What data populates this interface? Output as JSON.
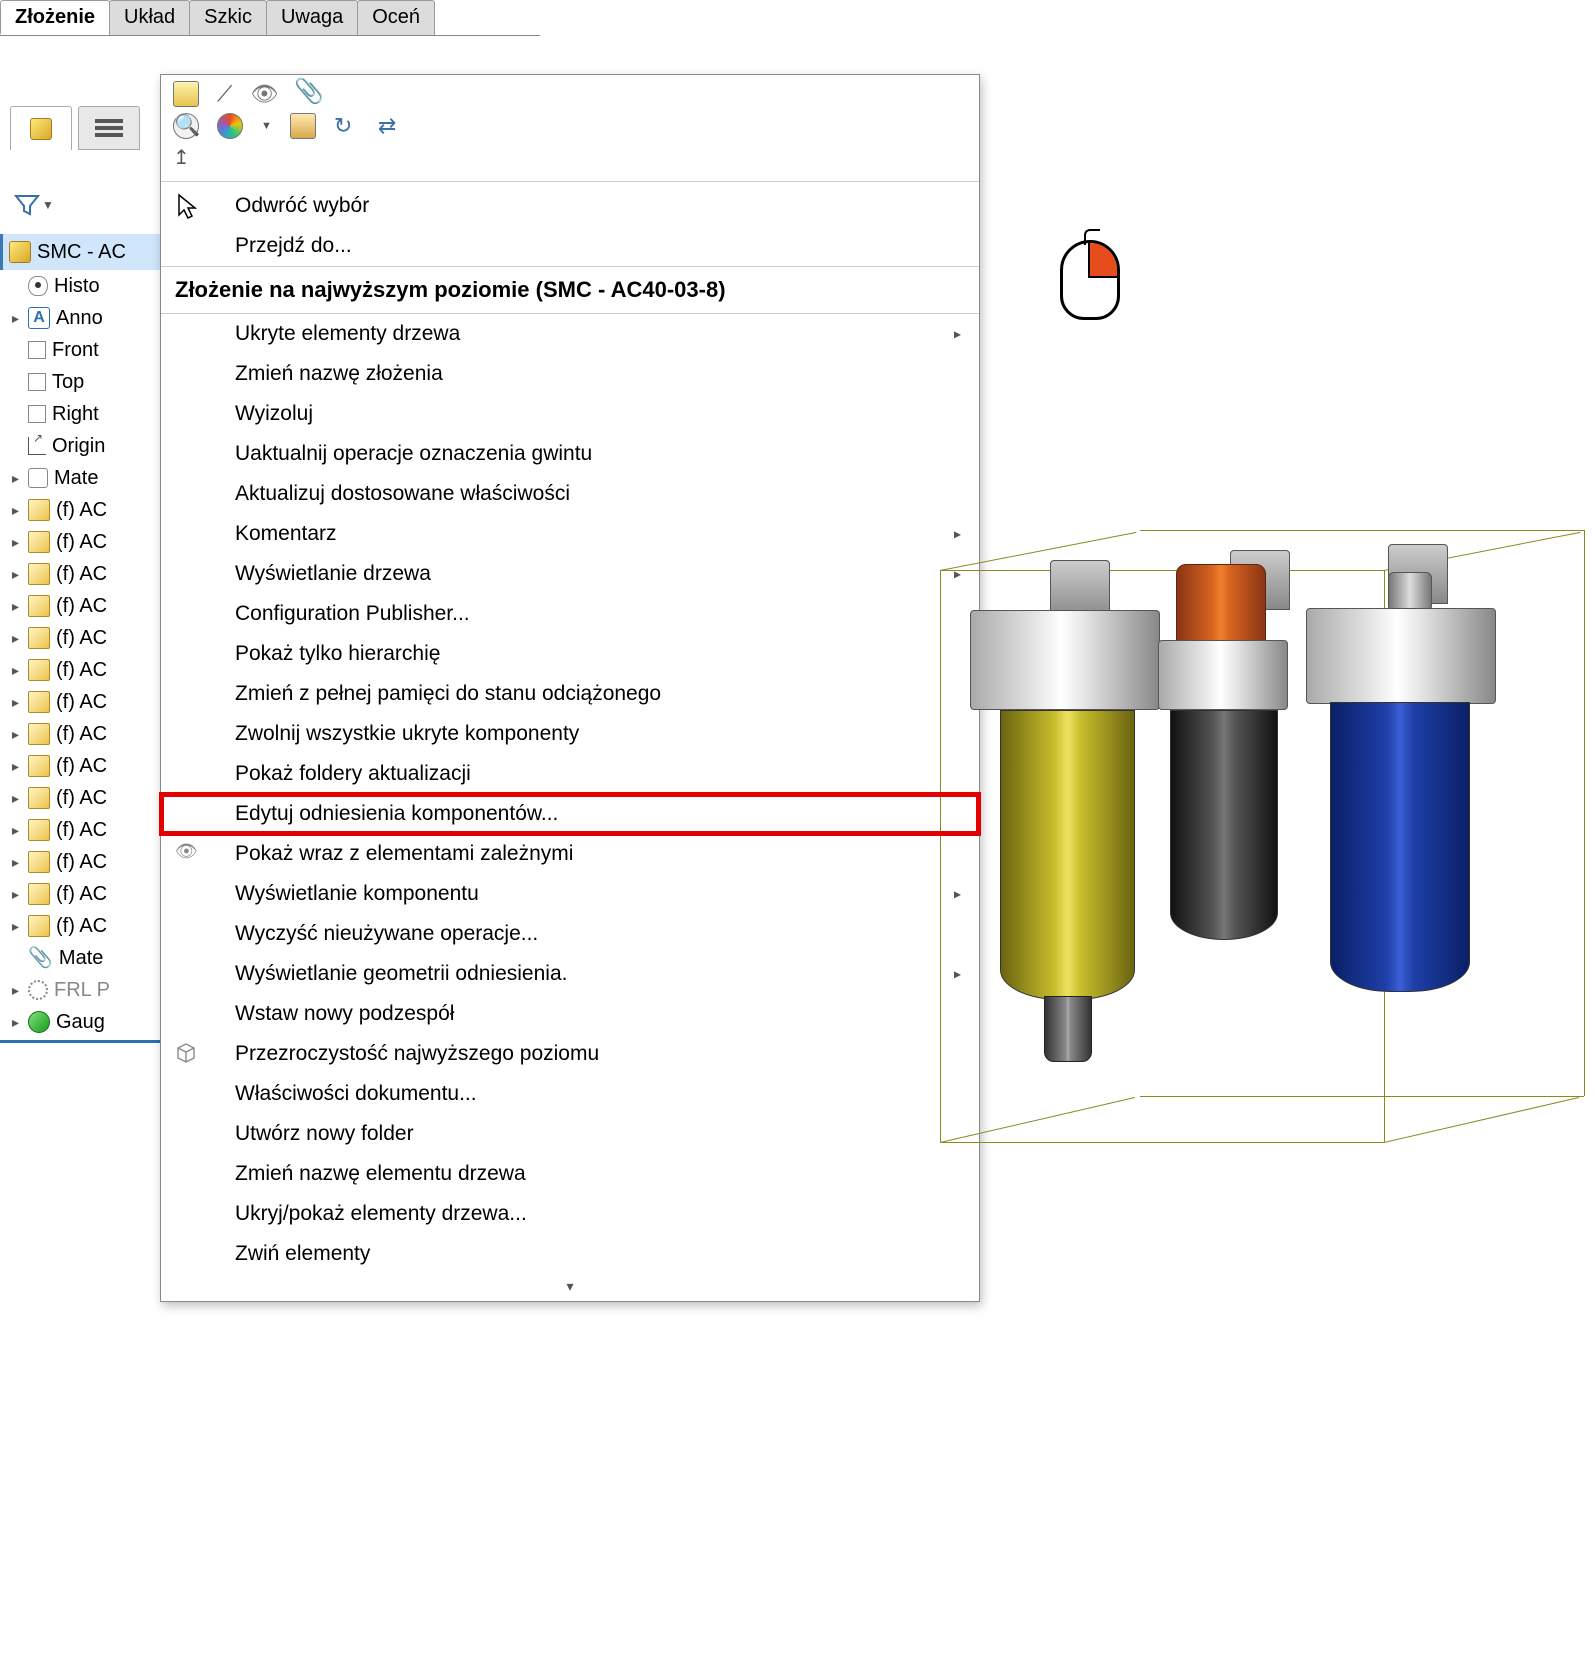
{
  "menubar": {
    "tabs": [
      "Złożenie",
      "Układ",
      "Szkic",
      "Uwaga",
      "Oceń"
    ],
    "active_index": 0
  },
  "tree": {
    "root": "SMC - AC",
    "items": [
      {
        "label": "Histo",
        "icon": "eye",
        "arrow": false
      },
      {
        "label": "Anno",
        "icon": "A",
        "arrow": true
      },
      {
        "label": "Front",
        "icon": "plane",
        "arrow": false
      },
      {
        "label": "Top",
        "icon": "plane",
        "arrow": false
      },
      {
        "label": "Right",
        "icon": "plane",
        "arrow": false
      },
      {
        "label": "Origin",
        "icon": "origin",
        "arrow": false
      },
      {
        "label": "Mate",
        "icon": "mate",
        "arrow": true
      },
      {
        "label": "(f) AC",
        "icon": "part",
        "arrow": true
      },
      {
        "label": "(f) AC",
        "icon": "part",
        "arrow": true
      },
      {
        "label": "(f) AC",
        "icon": "part",
        "arrow": true
      },
      {
        "label": "(f) AC",
        "icon": "part",
        "arrow": true
      },
      {
        "label": "(f) AC",
        "icon": "part",
        "arrow": true
      },
      {
        "label": "(f) AC",
        "icon": "part",
        "arrow": true
      },
      {
        "label": "(f) AC",
        "icon": "part",
        "arrow": true
      },
      {
        "label": "(f) AC",
        "icon": "part",
        "arrow": true
      },
      {
        "label": "(f) AC",
        "icon": "part",
        "arrow": true
      },
      {
        "label": "(f) AC",
        "icon": "part",
        "arrow": true
      },
      {
        "label": "(f) AC",
        "icon": "part",
        "arrow": true
      },
      {
        "label": "(f) AC",
        "icon": "part",
        "arrow": true
      },
      {
        "label": "(f) AC",
        "icon": "part",
        "arrow": true
      },
      {
        "label": "(f) AC",
        "icon": "part",
        "arrow": true
      },
      {
        "label": "Mate",
        "icon": "clip",
        "arrow": false
      },
      {
        "label": "FRL P",
        "icon": "gear",
        "arrow": true,
        "gray": true
      },
      {
        "label": "Gaug",
        "icon": "gauge",
        "arrow": true
      }
    ]
  },
  "context_menu": {
    "top_items": [
      {
        "label": "Odwróć wybór",
        "icon": "cursor"
      },
      {
        "label": "Przejdź do..."
      }
    ],
    "header": "Złożenie na najwyższym poziomie (SMC - AC40-03-8)",
    "items": [
      {
        "label": "Ukryte elementy drzewa",
        "submenu": true
      },
      {
        "label": "Zmień nazwę złożenia"
      },
      {
        "label": "Wyizoluj"
      },
      {
        "label": "Uaktualnij operacje oznaczenia gwintu"
      },
      {
        "label": "Aktualizuj dostosowane właściwości"
      },
      {
        "label": "Komentarz",
        "submenu": true
      },
      {
        "label": "Wyświetlanie drzewa",
        "submenu": true
      },
      {
        "label": "Configuration Publisher..."
      },
      {
        "label": "Pokaż tylko hierarchię"
      },
      {
        "label": "Zmień z pełnej pamięci do stanu odciążonego"
      },
      {
        "label": "Zwolnij wszystkie ukryte komponenty"
      },
      {
        "label": "Pokaż foldery aktualizacji"
      },
      {
        "label": "Edytuj odniesienia komponentów...",
        "highlighted": true
      },
      {
        "label": "Pokaż wraz z elementami zależnymi",
        "icon": "eye-strike"
      },
      {
        "label": "Wyświetlanie komponentu",
        "submenu": true
      },
      {
        "label": "Wyczyść nieużywane operacje..."
      },
      {
        "label": "Wyświetlanie geometrii odniesienia.",
        "submenu": true
      },
      {
        "label": "Wstaw nowy podzespół"
      },
      {
        "label": "Przezroczystość najwyższego poziomu",
        "icon": "cube"
      },
      {
        "label": "Właściwości dokumentu..."
      },
      {
        "label": "Utwórz nowy folder"
      },
      {
        "label": "Zmień nazwę elementu drzewa"
      },
      {
        "label": "Ukryj/pokaż elementy drzewa..."
      },
      {
        "label": "Zwiń elementy"
      }
    ],
    "footer_glyph": "▾"
  }
}
